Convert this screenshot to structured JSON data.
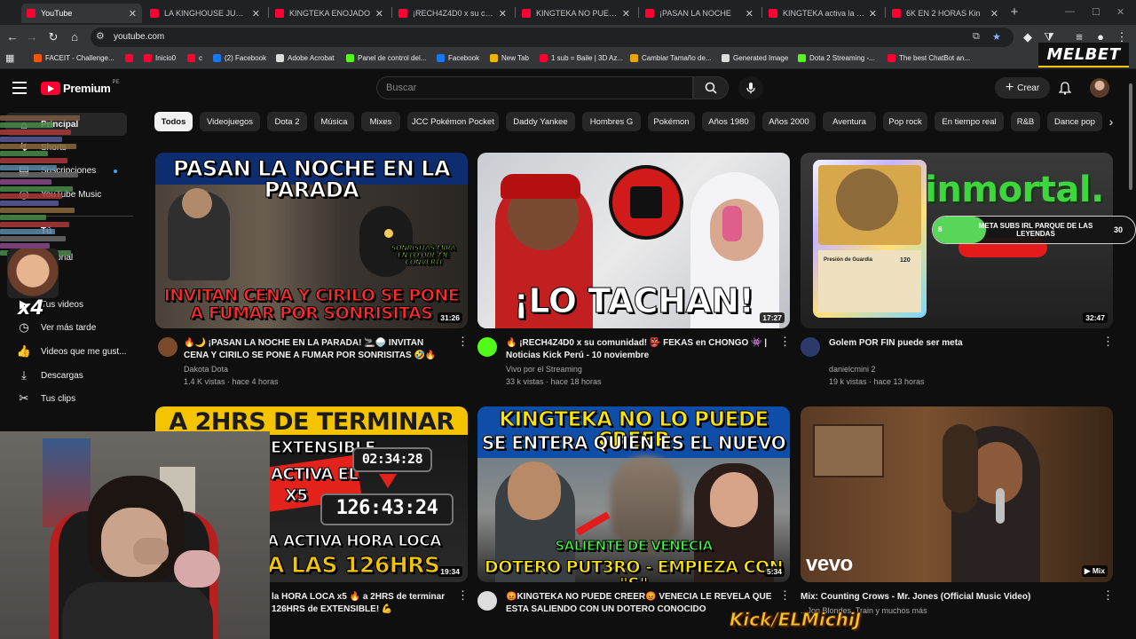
{
  "browser": {
    "tabs": [
      {
        "title": "YouTube",
        "active": true
      },
      {
        "title": "LA KINGHOUSE JUEGA PA"
      },
      {
        "title": "KINGTEKA ENOJADO"
      },
      {
        "title": "¡RECH4Z4D0 x su com"
      },
      {
        "title": "KINGTEKA NO PUEDE"
      },
      {
        "title": "¡PASAN LA NOCHE"
      },
      {
        "title": "KINGTEKA activa la Ho"
      },
      {
        "title": "6K EN 2 HORAS Kin"
      }
    ],
    "url": "youtube.com",
    "bookmarks": [
      {
        "label": "FACEIT - Challenge...",
        "color": "#ff5500"
      },
      {
        "label": "Inicio0",
        "color": "#ff0033"
      },
      {
        "label": "c",
        "color": "#ff0033"
      },
      {
        "label": "(2) Facebook",
        "color": "#1877f2"
      },
      {
        "label": "Adobe Acrobat",
        "color": "#dddddd"
      },
      {
        "label": "Panel de control del...",
        "color": "#53fc18"
      },
      {
        "label": "Facebook",
        "color": "#1877f2"
      },
      {
        "label": "New Tab",
        "color": "#f4b400"
      },
      {
        "label": "1 sub = Baile | 3D Az...",
        "color": "#ff0033"
      },
      {
        "label": "Cambiar Tamaño de...",
        "color": "#e8a500"
      },
      {
        "label": "Generated Image",
        "color": "#dddddd"
      },
      {
        "label": "Dota 2 Streaming -...",
        "color": "#53fc18"
      },
      {
        "label": "The best ChatBot an...",
        "color": "#ff0033"
      }
    ],
    "sponsor": "MELBET"
  },
  "masthead": {
    "logo": "Premium",
    "country": "PE",
    "search_placeholder": "Buscar",
    "create_label": "Crear"
  },
  "sidebar": {
    "items": [
      {
        "label": "Principal",
        "icon": "home-icon",
        "active": true
      },
      {
        "label": "Shorts",
        "icon": "shorts-icon"
      },
      {
        "label": "Suscripciones",
        "icon": "subscriptions-icon"
      },
      {
        "label": "YouTube Music",
        "icon": "music-icon"
      }
    ],
    "section_title": "Tú",
    "section_items": [
      {
        "label": "Historial",
        "icon": "history-icon"
      },
      {
        "label": "Tus videos",
        "icon": "your-videos-icon"
      },
      {
        "label": "Ver más tarde",
        "icon": "watch-later-icon"
      },
      {
        "label": "Videos que me gust...",
        "icon": "liked-icon"
      },
      {
        "label": "Descargas",
        "icon": "download-icon"
      },
      {
        "label": "Tus clips",
        "icon": "clips-icon"
      }
    ],
    "emote_text": "x4"
  },
  "chips": [
    "Todos",
    "Videojuegos",
    "Dota 2",
    "Música",
    "Mixes",
    "JCC Pokémon Pocket",
    "Daddy Yankee",
    "Hombres G",
    "Pokémon",
    "Años 1980",
    "Años 2000",
    "Aventura",
    "Pop rock",
    "En tiempo real",
    "R&B",
    "Dance pop"
  ],
  "videos": [
    {
      "thumb_title": "PASAN LA NOCHE EN LA PARADA",
      "thumb_sub": "INVITAN CENA Y CIRILO SE PONE A FUMAR POR SONRISITAS",
      "thumb_note": "SONRISITAS MIRA EN LO QUE ME CONVERTÍ",
      "duration": "31:26",
      "title": "🔥🌙 ¡PASAN LA NOCHE EN LA PARADA! 🚬🍚 INVITAN CENA Y CIRILO SE PONE A FUMAR POR SONRISITAS 🤣🔥",
      "channel": "Dakota Dota",
      "stats": "1.4 K vistas · hace 4 horas",
      "avatar_color": "#7a4a2a"
    },
    {
      "thumb_title": "¡LO TACHAN!",
      "duration": "17:27",
      "title": "🔥 ¡RECH4Z4D0 x su comunidad! 👺 FEKAS en CHONGO 👾 | Noticias Kick Perú - 10 noviembre",
      "channel": "Vivo por el Streaming",
      "stats": "33 k vistas · hace 18 horas",
      "avatar_color": "#53fc18"
    },
    {
      "thumb_title": "inmortal.",
      "thumb_note": "META SUBS IRL PARQUE DE LAS LEYENDAS",
      "thumb_count": "30",
      "thumb_count_left": "8",
      "card_hp": "120",
      "card_attack": "Presión de Guardia",
      "duration": "32:47",
      "title": "Golem POR FIN puede ser meta",
      "channel": "danielcmini 2",
      "stats": "19 k vistas · hace 13 horas",
      "avatar_color": "#2b3a6b"
    },
    {
      "thumb_title": "A 2HRS DE TERMINAR",
      "thumb_line2": "EXTENSIBLE",
      "thumb_line3": "ACTIVA EL",
      "thumb_x5": "X5",
      "thumb_timer1": "02:34:28",
      "thumb_timer2": "126:43:24",
      "thumb_sub": "A ACTIVA HORA LOCA",
      "thumb_sub2": "A LAS 126HRS",
      "duration": "19:34",
      "title": "la HORA LOCA x5 🔥 a 2HRS de terminar 126HRS de EXTENSIBLE! 💪",
      "channel": "",
      "stats": "",
      "avatar_color": "#9a6a3a"
    },
    {
      "thumb_title": "KINGTEKA NO LO PUEDE CREER",
      "thumb_sub": "SE ENTERA QUIEN ES EL NUEVO",
      "thumb_note": "SALIENTE DE VENECIA",
      "thumb_bottom": "DOTERO PUT3RO - EMPIEZA CON \"S\"",
      "duration": "5:34",
      "title": "😡KINGTEKA NO PUEDE CREER😡 VENECIA LE REVELA QUE ESTA SALIENDO CON UN DOTERO CONOCIDO",
      "channel": "",
      "stats": "",
      "avatar_color": "#dddddd"
    },
    {
      "thumb_title": "vevo",
      "duration": "Mix",
      "title": "Mix: Counting Crows - Mr. Jones (Official Music Video)",
      "channel": "...Jon Blondes, Train y muchos más",
      "stats": "",
      "avatar_color": "#3a3a3a"
    }
  ],
  "overlay": {
    "kick": "Kick/ELMichiJ"
  }
}
